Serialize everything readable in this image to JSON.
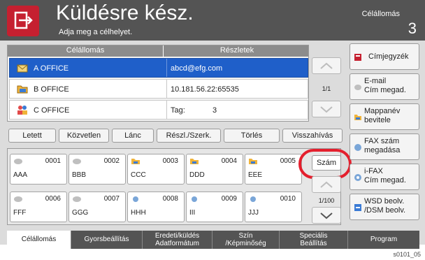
{
  "header": {
    "title": "Küldésre kész.",
    "subtitle": "Adja meg a célhelyet.",
    "dest_label": "Célállomás",
    "dest_count": "3"
  },
  "destination_table": {
    "columns": [
      "Célállomás",
      "Részletek"
    ],
    "rows": [
      {
        "name": "A OFFICE",
        "detail": "abcd@efg.com",
        "detail2": "",
        "icon": "email-icon",
        "selected": true
      },
      {
        "name": "B OFFICE",
        "detail": "10.181.56.22:65535",
        "detail2": "",
        "icon": "folder-icon",
        "selected": false
      },
      {
        "name": "C OFFICE",
        "detail": "Tag:",
        "detail2": "3",
        "icon": "group-icon",
        "selected": false
      }
    ],
    "page": "1/1"
  },
  "tabs": {
    "items": [
      "Letett",
      "Közvetlen",
      "Lánc",
      "Részl./Szerk.",
      "Törlés",
      "Visszahívás"
    ]
  },
  "quick_dial": {
    "row1": [
      {
        "num": "0001",
        "name": "AAA",
        "icon": "email-icon"
      },
      {
        "num": "0002",
        "name": "BBB",
        "icon": "email-icon"
      },
      {
        "num": "0003",
        "name": "CCC",
        "icon": "folder-icon"
      },
      {
        "num": "0004",
        "name": "DDD",
        "icon": "folder-icon"
      },
      {
        "num": "0005",
        "name": "EEE",
        "icon": "folder-icon"
      }
    ],
    "row2": [
      {
        "num": "0006",
        "name": "FFF",
        "icon": "email-icon"
      },
      {
        "num": "0007",
        "name": "GGG",
        "icon": "email-icon"
      },
      {
        "num": "0008",
        "name": "HHH",
        "icon": "fax-icon"
      },
      {
        "num": "0009",
        "name": "III",
        "icon": "fax-icon"
      },
      {
        "num": "0010",
        "name": "JJJ",
        "icon": "fax-icon"
      }
    ],
    "szam": "Szám",
    "page": "1/100"
  },
  "right_buttons": [
    {
      "line1": "Címjegyzék",
      "line2": "",
      "icon": "address-book-icon"
    },
    {
      "line1": "E-mail",
      "line2": "Cím megad.",
      "icon": "email-icon"
    },
    {
      "line1": "Mappanév",
      "line2": "bevitele",
      "icon": "folder-icon"
    },
    {
      "line1": "FAX szám",
      "line2": "megadása",
      "icon": "fax-icon"
    },
    {
      "line1": "i-FAX",
      "line2": "Cím megad.",
      "icon": "ifax-icon"
    },
    {
      "line1": "WSD beolv.",
      "line2": "/DSM beolv.",
      "icon": "wsd-icon"
    }
  ],
  "bottom_tabs": [
    {
      "line1": "Célállomás",
      "line2": "",
      "active": true
    },
    {
      "line1": "Gyorsbeállítás",
      "line2": "",
      "active": false
    },
    {
      "line1": "Eredeti/küldés",
      "line2": "Adatformátum",
      "active": false
    },
    {
      "line1": "Szín",
      "line2": "/Képminőség",
      "active": false
    },
    {
      "line1": "Speciális",
      "line2": "Beállítás",
      "active": false
    },
    {
      "line1": "Program",
      "line2": "",
      "active": false
    }
  ],
  "figure_id": "s0101_05",
  "colors": {
    "accent_red": "#c52030",
    "selected_blue": "#1f5fc9",
    "header_gray": "#545454",
    "highlight_circle": "#e41f2d"
  }
}
